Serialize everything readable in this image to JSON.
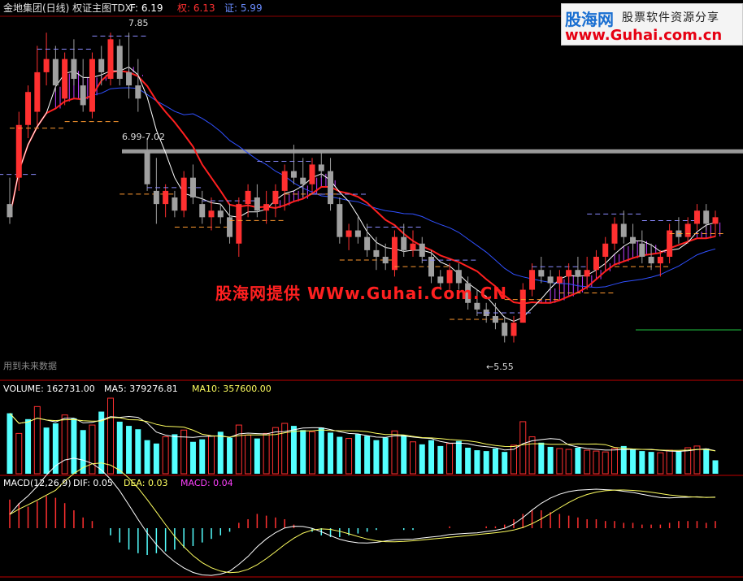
{
  "header": {
    "title": "金地集团(日线) 权证主图TDX",
    "f_label": "F: 6.19",
    "quan_label": "权: 6.13",
    "zheng_label": "证: 5.99"
  },
  "annotations": {
    "high": "7.85",
    "range": "6.99-7.02",
    "low": "←5.55",
    "future": "用到未来数据"
  },
  "watermark": {
    "logo": "股海网",
    "slogan": "股票软件资源分享",
    "url": "www.Guhai.com.cn",
    "center": "股海网提供 WWw.Guhai.Com.CN"
  },
  "volume_panel": {
    "vol": "VOLUME: 162731.00",
    "ma5": "MA5: 379276.81",
    "ma10": "MA10: 357600.00"
  },
  "macd_panel": {
    "name": "MACD(12,26,9)",
    "dif": "DIF: 0.05",
    "dea": "DEA: 0.03",
    "macd": "MACD: 0.04"
  },
  "colors": {
    "up": "#ff3030",
    "down": "#a0a0a0",
    "vol_down": "#54ffff",
    "ma_red": "#ff2020",
    "ma_white": "#ffffff",
    "ma_blue": "#3050ff",
    "fill_magenta": "#c040ff",
    "resist_gray": "#9a9a9a",
    "dash_blue": "#8a8aff",
    "dash_orange": "#ff9a30",
    "green_line": "#20c040"
  },
  "chart_data": {
    "type": "candlestick",
    "y_range": [
      5.3,
      8.0
    ],
    "horizontal_level": 7.0,
    "candles": [
      [
        6.6,
        6.8,
        6.45,
        6.5
      ],
      [
        6.8,
        7.3,
        6.7,
        7.2
      ],
      [
        7.2,
        7.5,
        7.1,
        7.45
      ],
      [
        7.3,
        7.8,
        7.2,
        7.6
      ],
      [
        7.6,
        7.9,
        7.5,
        7.7
      ],
      [
        7.7,
        7.8,
        7.45,
        7.5
      ],
      [
        7.4,
        7.75,
        7.35,
        7.7
      ],
      [
        7.7,
        7.85,
        7.5,
        7.55
      ],
      [
        7.5,
        7.7,
        7.3,
        7.35
      ],
      [
        7.3,
        7.75,
        7.25,
        7.7
      ],
      [
        7.7,
        7.8,
        7.5,
        7.6
      ],
      [
        7.55,
        7.9,
        7.5,
        7.85
      ],
      [
        7.8,
        7.85,
        7.5,
        7.55
      ],
      [
        7.6,
        7.9,
        7.4,
        7.5
      ],
      [
        7.5,
        7.7,
        7.3,
        7.4
      ],
      [
        7.0,
        7.1,
        6.7,
        6.75
      ],
      [
        6.7,
        6.95,
        6.45,
        6.6
      ],
      [
        6.6,
        6.75,
        6.5,
        6.7
      ],
      [
        6.65,
        6.7,
        6.5,
        6.55
      ],
      [
        6.55,
        6.85,
        6.5,
        6.8
      ],
      [
        6.8,
        6.9,
        6.6,
        6.65
      ],
      [
        6.6,
        6.7,
        6.45,
        6.5
      ],
      [
        6.5,
        6.65,
        6.4,
        6.55
      ],
      [
        6.55,
        6.6,
        6.45,
        6.5
      ],
      [
        6.5,
        6.6,
        6.3,
        6.35
      ],
      [
        6.3,
        6.65,
        6.2,
        6.6
      ],
      [
        6.6,
        6.75,
        6.5,
        6.7
      ],
      [
        6.65,
        6.75,
        6.5,
        6.55
      ],
      [
        6.55,
        6.7,
        6.45,
        6.6
      ],
      [
        6.6,
        6.75,
        6.5,
        6.7
      ],
      [
        6.7,
        6.9,
        6.55,
        6.85
      ],
      [
        6.85,
        7.05,
        6.75,
        6.8
      ],
      [
        6.8,
        6.95,
        6.65,
        6.75
      ],
      [
        6.75,
        6.95,
        6.7,
        6.9
      ],
      [
        6.9,
        7.0,
        6.8,
        6.85
      ],
      [
        6.85,
        6.95,
        6.55,
        6.6
      ],
      [
        6.6,
        6.65,
        6.3,
        6.35
      ],
      [
        6.35,
        6.45,
        6.25,
        6.4
      ],
      [
        6.4,
        6.5,
        6.3,
        6.35
      ],
      [
        6.35,
        6.45,
        6.2,
        6.25
      ],
      [
        6.25,
        6.35,
        6.1,
        6.2
      ],
      [
        6.2,
        6.3,
        6.1,
        6.15
      ],
      [
        6.1,
        6.4,
        6.05,
        6.35
      ],
      [
        6.35,
        6.45,
        6.2,
        6.25
      ],
      [
        6.25,
        6.4,
        6.2,
        6.3
      ],
      [
        6.3,
        6.35,
        6.15,
        6.2
      ],
      [
        6.2,
        6.25,
        6.0,
        6.05
      ],
      [
        6.05,
        6.1,
        5.95,
        6.0
      ],
      [
        6.0,
        6.15,
        5.95,
        6.1
      ],
      [
        6.1,
        6.15,
        5.95,
        6.0
      ],
      [
        6.0,
        6.05,
        5.8,
        5.85
      ],
      [
        5.85,
        5.95,
        5.75,
        5.8
      ],
      [
        5.8,
        5.85,
        5.7,
        5.75
      ],
      [
        5.75,
        5.85,
        5.65,
        5.7
      ],
      [
        5.7,
        5.75,
        5.55,
        5.6
      ],
      [
        5.6,
        5.75,
        5.55,
        5.7
      ],
      [
        5.7,
        6.0,
        5.7,
        5.95
      ],
      [
        5.95,
        6.15,
        5.9,
        6.1
      ],
      [
        6.1,
        6.2,
        6.0,
        6.05
      ],
      [
        6.05,
        6.1,
        5.95,
        6.0
      ],
      [
        6.0,
        6.1,
        5.95,
        6.05
      ],
      [
        6.05,
        6.15,
        6.0,
        6.1
      ],
      [
        6.1,
        6.2,
        6.0,
        6.05
      ],
      [
        6.05,
        6.2,
        5.95,
        6.1
      ],
      [
        6.1,
        6.25,
        6.05,
        6.2
      ],
      [
        6.2,
        6.35,
        6.1,
        6.3
      ],
      [
        6.3,
        6.5,
        6.25,
        6.45
      ],
      [
        6.45,
        6.55,
        6.3,
        6.35
      ],
      [
        6.35,
        6.45,
        6.25,
        6.3
      ],
      [
        6.3,
        6.4,
        6.15,
        6.2
      ],
      [
        6.2,
        6.3,
        6.1,
        6.15
      ],
      [
        6.15,
        6.25,
        6.05,
        6.2
      ],
      [
        6.2,
        6.45,
        6.15,
        6.4
      ],
      [
        6.4,
        6.5,
        6.3,
        6.35
      ],
      [
        6.35,
        6.5,
        6.3,
        6.45
      ],
      [
        6.45,
        6.6,
        6.4,
        6.55
      ],
      [
        6.55,
        6.6,
        6.4,
        6.45
      ],
      [
        6.45,
        6.55,
        6.35,
        6.5
      ]
    ],
    "volume": [
      72,
      48,
      65,
      80,
      55,
      60,
      70,
      66,
      52,
      58,
      74,
      90,
      62,
      57,
      53,
      40,
      36,
      44,
      47,
      52,
      38,
      41,
      45,
      50,
      43,
      58,
      46,
      42,
      48,
      55,
      60,
      57,
      52,
      50,
      55,
      49,
      44,
      42,
      47,
      45,
      40,
      43,
      51,
      46,
      38,
      35,
      40,
      33,
      36,
      39,
      31,
      28,
      27,
      30,
      26,
      34,
      62,
      44,
      37,
      32,
      30,
      29,
      31,
      28,
      27,
      26,
      30,
      33,
      29,
      27,
      26,
      25,
      28,
      27,
      31,
      33,
      30,
      16
    ],
    "vol_up": [
      false,
      true,
      false,
      true,
      false,
      false,
      true,
      false,
      false,
      true,
      false,
      true,
      false,
      false,
      false,
      false,
      false,
      true,
      false,
      true,
      false,
      false,
      true,
      false,
      false,
      true,
      true,
      false,
      true,
      true,
      true,
      false,
      false,
      true,
      false,
      false,
      false,
      true,
      false,
      false,
      false,
      false,
      true,
      false,
      true,
      false,
      false,
      false,
      true,
      false,
      false,
      false,
      false,
      false,
      false,
      true,
      true,
      true,
      false,
      false,
      true,
      true,
      false,
      true,
      true,
      true,
      true,
      false,
      false,
      false,
      false,
      true,
      true,
      false,
      true,
      true,
      false,
      false
    ],
    "macd_hist": [
      0.16,
      0.14,
      0.12,
      0.15,
      0.18,
      0.17,
      0.14,
      0.1,
      0.06,
      0.04,
      0.0,
      -0.04,
      -0.08,
      -0.12,
      -0.14,
      -0.15,
      -0.14,
      -0.13,
      -0.12,
      -0.11,
      -0.1,
      -0.08,
      -0.06,
      -0.04,
      -0.02,
      0.03,
      0.05,
      0.08,
      0.07,
      0.06,
      0.05,
      0.02,
      0.0,
      -0.02,
      -0.04,
      -0.05,
      -0.05,
      -0.04,
      -0.03,
      -0.02,
      -0.01,
      0.0,
      0.0,
      -0.01,
      -0.01,
      0.0,
      0.0,
      0.0,
      0.01,
      0.0,
      0.0,
      0.0,
      0.01,
      0.01,
      0.02,
      0.05,
      0.08,
      0.1,
      0.1,
      0.09,
      0.08,
      0.07,
      0.06,
      0.05,
      0.05,
      0.04,
      0.04,
      0.03,
      0.03,
      0.02,
      0.02,
      0.02,
      0.03,
      0.04,
      0.04,
      0.04,
      0.03,
      0.04
    ]
  }
}
